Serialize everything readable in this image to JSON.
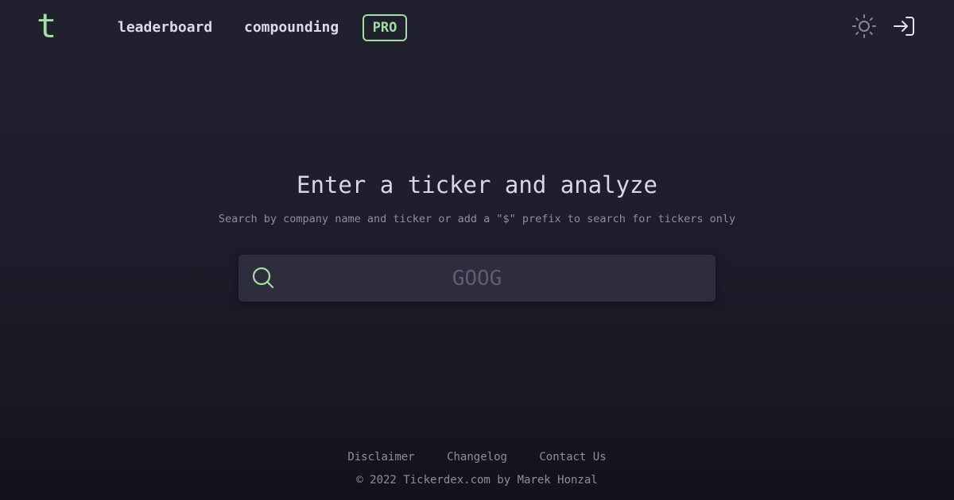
{
  "header": {
    "logo": "t",
    "nav": {
      "leaderboard": "leaderboard",
      "compounding": "compounding",
      "pro": "PRO"
    },
    "icons": {
      "theme": "sun-icon",
      "login": "login-icon"
    }
  },
  "hero": {
    "title": "Enter a ticker and analyze",
    "subtitle": "Search by company name and ticker or add a \"$\" prefix to search for tickers only"
  },
  "search": {
    "placeholder": "GOOG",
    "value": "",
    "icon": "search-icon"
  },
  "footer": {
    "links": {
      "disclaimer": "Disclaimer",
      "changelog": "Changelog",
      "contact": "Contact Us"
    },
    "copyright": "© 2022 Tickerdex.com by Marek Honzal"
  },
  "colors": {
    "accent": "#a4dca4",
    "background": "#1f1e2d",
    "search_bg": "#2e2d3e",
    "muted_text": "#8f8ca1"
  }
}
